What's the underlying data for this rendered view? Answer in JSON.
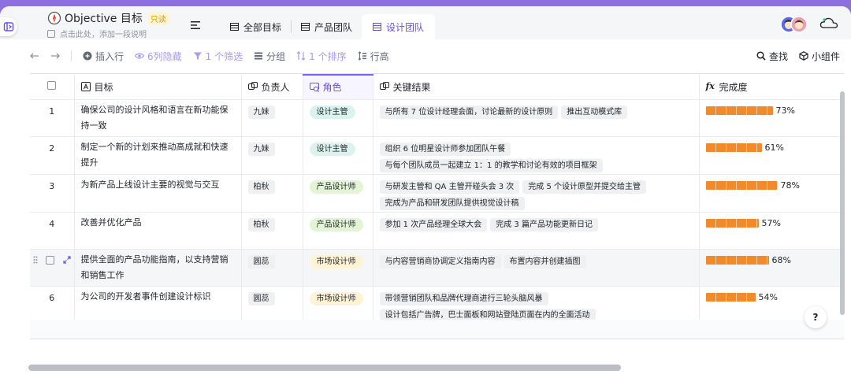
{
  "header": {
    "title": "Objective 目标",
    "readonly_badge": "只读",
    "description_placeholder": "点击此处，添加一段说明",
    "tabs": [
      {
        "label": "全部目标",
        "active": false
      },
      {
        "label": "产品团队",
        "active": false
      },
      {
        "label": "设计团队",
        "active": true
      }
    ]
  },
  "toolbar": {
    "insert_row": "插入行",
    "hidden_cols": "6列隐藏",
    "filter": "1 个筛选",
    "group": "分组",
    "sort": "1 个排序",
    "row_height": "行高",
    "find": "查找",
    "widget": "小组件"
  },
  "columns": {
    "goal": "目标",
    "owner": "负责人",
    "role": "角色",
    "key_results": "关键结果",
    "completion": "完成度"
  },
  "colors": {
    "accent": "#7b61ff",
    "progress": "#f08a2a",
    "role_manager_bg": "#dcf2ec",
    "role_product_bg": "#e4f5d6",
    "role_market_bg": "#fff3d6"
  },
  "rows": [
    {
      "index": "1",
      "goal": "确保公司的设计风格和语言在新功能保持一致",
      "owner": "九妹",
      "role": "设计主管",
      "role_kind": "manager",
      "key_results": [
        "与所有 7 位设计经理会面，讨论最新的设计原则",
        "推出互动模式库"
      ],
      "progress": 73,
      "progress_label": "73%"
    },
    {
      "index": "2",
      "goal": "制定一个新的计划来推动高成就和快速提升",
      "owner": "九妹",
      "role": "设计主管",
      "role_kind": "manager",
      "key_results": [
        "组织 6 位明星设计师参加团队午餐",
        "与每个团队成员一起建立 1：1 的教学和讨论有效的项目框架"
      ],
      "progress": 61,
      "progress_label": "61%"
    },
    {
      "index": "3",
      "goal": "为新产品上线设计主要的视觉与交互",
      "owner": "柏秋",
      "role": "产品设计师",
      "role_kind": "product",
      "key_results": [
        "与研发主管和 QA 主管开碰头会 3 次",
        "完成 5 个设计原型并提交给主管",
        "完成为产品和研发团队提供视觉设计稿"
      ],
      "progress": 78,
      "progress_label": "78%"
    },
    {
      "index": "4",
      "goal": "改善并优化产品",
      "owner": "柏秋",
      "role": "产品设计师",
      "role_kind": "product",
      "key_results": [
        "参加 1 次产品经理全球大会",
        "完成 3 篇产品功能更新日记"
      ],
      "progress": 57,
      "progress_label": "57%"
    },
    {
      "index": "",
      "goal": "提供全面的产品功能指南，以支持营销和销售工作",
      "owner": "圆蕊",
      "role": "市场设计师",
      "role_kind": "market",
      "key_results": [
        "与内容营销商协调定义指南内容",
        "布置内容并创建插图"
      ],
      "progress": 68,
      "progress_label": "68%",
      "hover": true
    },
    {
      "index": "6",
      "goal": "为公司的开发者事件创建设计标识",
      "owner": "圆蕊",
      "role": "市场设计师",
      "role_kind": "market",
      "key_results": [
        "带领营销团队和品牌代理商进行三轮头脑风暴",
        "设计包括广告牌，巴士面板和网站登陆页面在内的全面活动"
      ],
      "progress": 54,
      "progress_label": "54%"
    }
  ],
  "help_label": "?"
}
